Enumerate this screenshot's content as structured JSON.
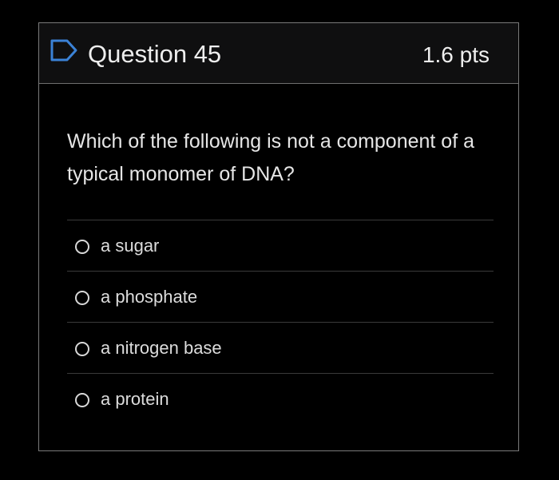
{
  "question": {
    "title": "Question 45",
    "points": "1.6 pts",
    "text": "Which of the following is not a component of a typical monomer of DNA?",
    "flag_icon": "flag-outline-icon",
    "accent_color": "#3b82d6"
  },
  "answers": [
    {
      "label": "a sugar",
      "selected": false
    },
    {
      "label": "a phosphate",
      "selected": false
    },
    {
      "label": "a nitrogen base",
      "selected": false
    },
    {
      "label": "a protein",
      "selected": false
    }
  ]
}
